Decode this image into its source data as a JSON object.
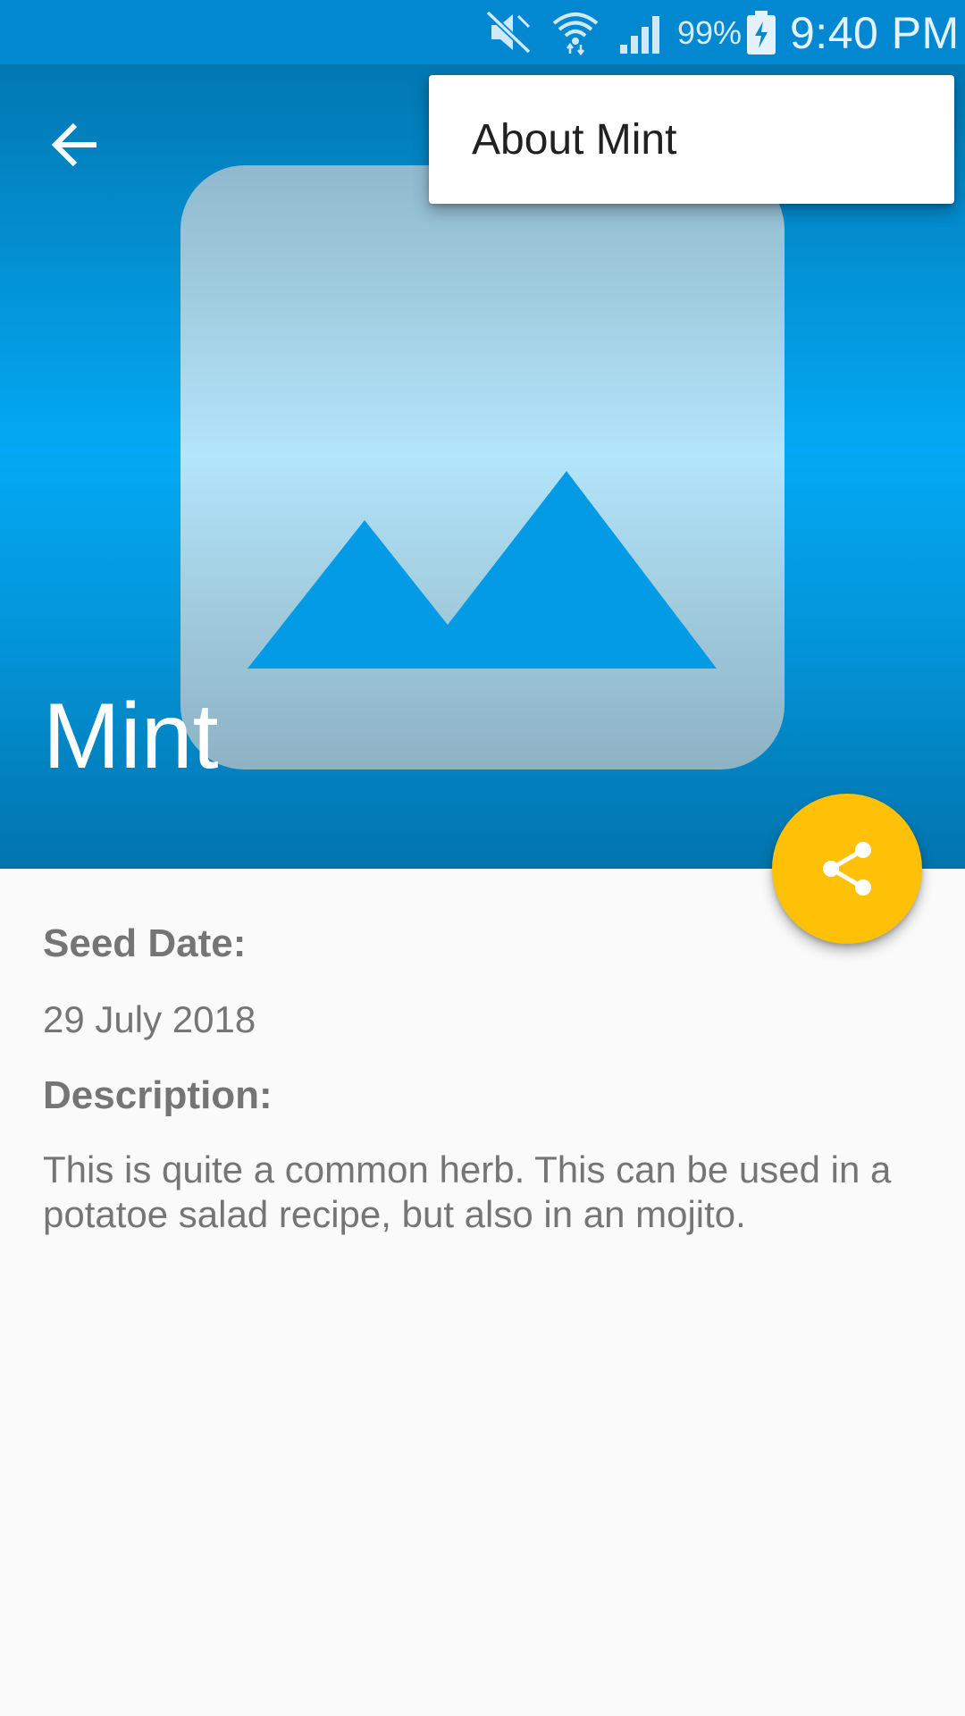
{
  "status_bar": {
    "battery_percent": "99%",
    "time": "9:40 PM",
    "icons": [
      "mute-icon",
      "wifi-icon",
      "signal-icon",
      "battery-charging-icon"
    ]
  },
  "header": {
    "title": "Mint",
    "back_icon": "arrow-back-icon",
    "image_icon": "image-placeholder-icon"
  },
  "menu": {
    "items": [
      {
        "label": "About Mint"
      }
    ]
  },
  "fab": {
    "icon": "share-icon"
  },
  "details": {
    "seed_date_label": "Seed Date:",
    "seed_date_value": "29 July 2018",
    "description_label": "Description:",
    "description_value": "This is quite a common herb. This can be used in a potatoe salad recipe, but also in an mojito."
  },
  "colors": {
    "primary": "#0288d1",
    "accent": "#ffc107",
    "background": "#fafafa",
    "text_secondary": "#757575"
  }
}
